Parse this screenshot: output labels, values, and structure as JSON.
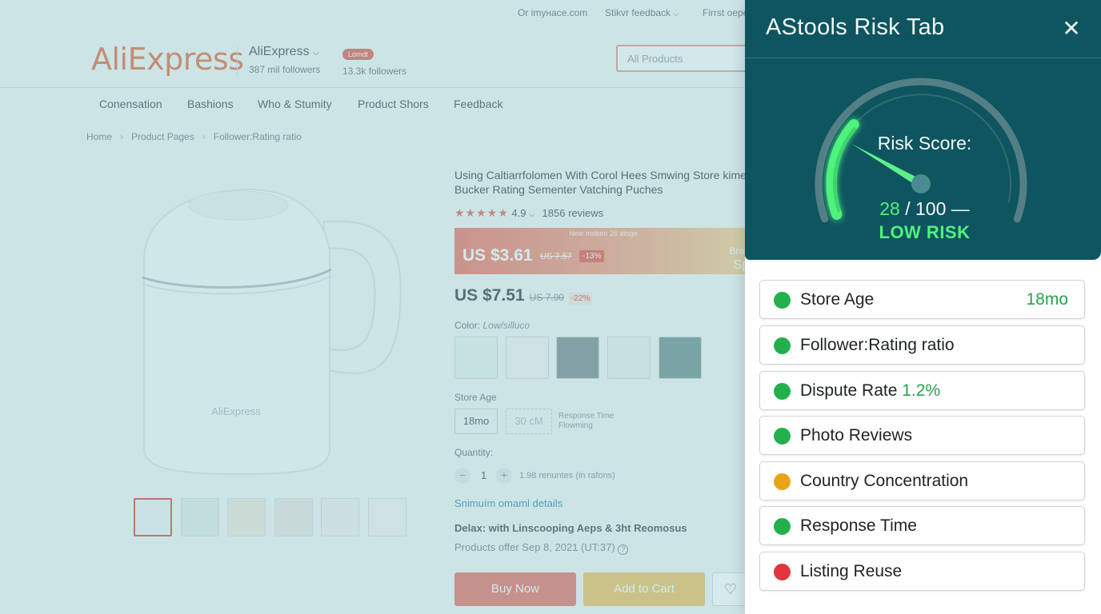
{
  "topbar": {
    "link1": "Or imyнace.com",
    "link2": "Stikvr feedback",
    "link3": "Firrst oepe"
  },
  "header": {
    "logo": "AliExpress",
    "store_name": "AliExpress",
    "store_followers": "387 mil followers",
    "badge": "Lomdt",
    "badge_followers": "13.3k followers",
    "search_placeholder": "All Products"
  },
  "nav": [
    "Conensation",
    "Bashions",
    "Who & Stumity",
    "Product Shors",
    "Feedback"
  ],
  "breadcrumb": [
    "Home",
    "Product Pages",
    "Follower:Rating ratio"
  ],
  "product": {
    "image_watermark": "AliExpress",
    "title_line1": "Using Caltiarrfolomen With Corol Hees Smwing Store kime",
    "title_line2": "Bucker Rating Sementer Vatching Puches",
    "stars": "★★★★★",
    "rating": "4.9",
    "reviews": "1856 reviews",
    "promo_top": "Nеw rnoken 26 atoge",
    "promo_price": "US $3.61",
    "promo_old": "US 7.57",
    "promo_off": "-13%",
    "promo_right1": "Brav",
    "promo_right2": "Sp",
    "price": "US $7.51",
    "price_old": "US 7.90",
    "price_off": "-22%",
    "color_label": "Color:",
    "color_value": "Low/silluco",
    "store_age_label": "Store Age",
    "opt1": "18mo",
    "opt2": "30 cM",
    "resp_label1": "Response Time",
    "resp_label2": "Flowming",
    "quantity_label": "Quantity:",
    "qty_minus": "−",
    "qty_value": "1",
    "qty_plus": "+",
    "qty_note": "1.98 renuntes (in rafons)",
    "details_link": "Snimuím omaml details",
    "delax": "Delax: with Linscooping Aeps & 3ht Reomosus",
    "offer": "Products offer Sep 8, 2021 (UT:37)",
    "buy_now": "Buy Now",
    "add_to_cart": "Add to Cart"
  },
  "panel": {
    "title": "AStools Risk Tab",
    "score_label": "Risk Score:",
    "score": "28",
    "score_suffix": " / 100 —",
    "score_value": 28,
    "score_max": 100,
    "risk_level": "LOW RISK",
    "colors": {
      "green": "#23b04c",
      "amber": "#e8a416",
      "red": "#e0353a",
      "glow": "#4ff27d"
    },
    "factors": [
      {
        "label": "Store Age",
        "value": "18mo",
        "status": "green"
      },
      {
        "label": "Follower:Rating ratio",
        "value": "",
        "status": "green"
      },
      {
        "label": "Dispute Rate",
        "inline": "1.2%",
        "status": "green"
      },
      {
        "label": "Photo Reviews",
        "value": "",
        "status": "green"
      },
      {
        "label": "Country Concentration",
        "value": "",
        "status": "amber"
      },
      {
        "label": "Response Time",
        "value": "",
        "status": "green"
      },
      {
        "label": "Listing Reuse",
        "value": "",
        "status": "red"
      }
    ]
  }
}
